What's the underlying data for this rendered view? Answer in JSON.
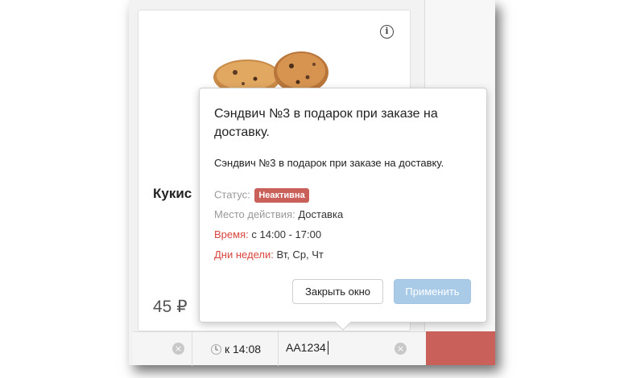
{
  "product": {
    "name": "Кукис",
    "price": "45 ₽"
  },
  "bottom_bar": {
    "clear_icon": "x",
    "time_label": "к 14:08",
    "code_value": "AA1234",
    "code_clear_icon": "x"
  },
  "popover": {
    "title": "Сэндвич №3 в подарок при заказе на доставку.",
    "description": "Сэндвич №3 в подарок при заказе на доставку.",
    "status_label": "Статус:",
    "status_badge": "Неактивна",
    "place_label": "Место действия:",
    "place_value": "Доставка",
    "time_label": "Время:",
    "time_value": "с 14:00 - 17:00",
    "days_label": "Дни недели:",
    "days_value": "Вт, Ср, Чт",
    "close_button": "Закрыть окно",
    "apply_button": "Применить"
  },
  "colors": {
    "accent_red": "#c9605a",
    "apply_disabled": "#a9cbe8",
    "label_red": "#d9453d"
  },
  "icons": {
    "info": "info-icon",
    "clock": "clock-icon",
    "clear": "clear-icon"
  }
}
